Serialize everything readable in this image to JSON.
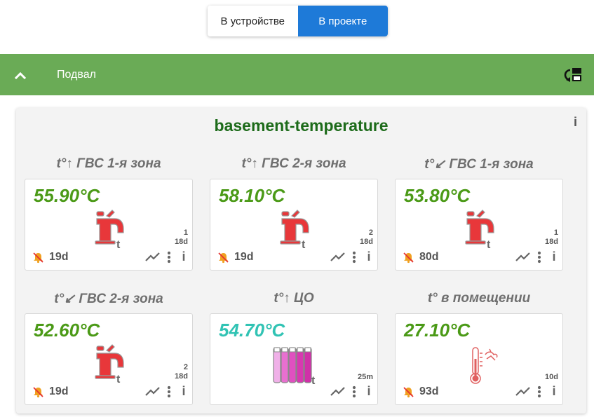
{
  "view_toggle": {
    "options": [
      "В устройстве",
      "В проекте"
    ],
    "selected": "В проекте"
  },
  "section": {
    "title": "Подвал"
  },
  "card": {
    "title": "basement-temperature",
    "info_label": "i",
    "widgets": [
      {
        "label": "t°↑ ГВС 1-я зона",
        "value": "55.90°C",
        "value_color": "#4b9a17",
        "icon": "faucet-icon",
        "meta_top": "1",
        "meta_bottom": "18d",
        "age": "19d",
        "alarm_muted": true
      },
      {
        "label": "t°↑ ГВС 2-я зона",
        "value": "58.10°C",
        "value_color": "#4b9a17",
        "icon": "faucet-icon",
        "meta_top": "2",
        "meta_bottom": "18d",
        "age": "19d",
        "alarm_muted": true
      },
      {
        "label": "t°↙ ГВС 1-я зона",
        "value": "53.80°C",
        "value_color": "#4b9a17",
        "icon": "faucet-icon",
        "meta_top": "1",
        "meta_bottom": "18d",
        "age": "80d",
        "alarm_muted": true
      },
      {
        "label": "t°↙ ГВС 2-я зона",
        "value": "52.60°C",
        "value_color": "#4b9a17",
        "icon": "faucet-icon",
        "meta_top": "2",
        "meta_bottom": "18d",
        "age": "19d",
        "alarm_muted": true
      },
      {
        "label": "t°↑ ЦО",
        "value": "54.70°C",
        "value_color": "#31c3b4",
        "icon": "radiator-icon",
        "meta_single": "25m"
      },
      {
        "label": "t° в помещении",
        "value": "27.10°C",
        "value_color": "#4b9a17",
        "icon": "thermometer-icon",
        "meta_single": "10d",
        "age": "93d",
        "alarm_muted": true
      }
    ]
  },
  "colors": {
    "accent_blue": "#1e7ad8",
    "section_green": "#6aab56",
    "title_green": "#1d6b1a",
    "value_green": "#4b9a17",
    "value_teal": "#31c3b4",
    "icon_red": "#e8373a",
    "icon_pink": "#e050c0",
    "bell_orange": "#f0a020"
  }
}
